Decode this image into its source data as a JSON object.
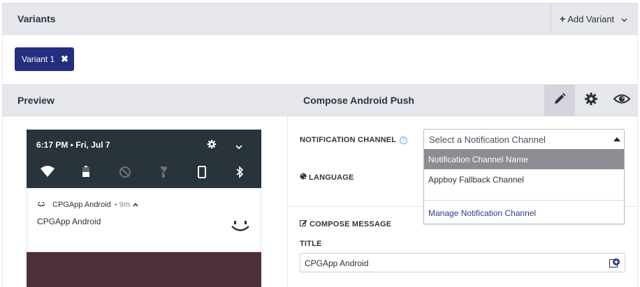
{
  "variants": {
    "title": "Variants",
    "add_variant_label": "Add Variant",
    "chips": [
      {
        "label": "Variant 1",
        "close": "✖"
      }
    ]
  },
  "preview": {
    "title": "Preview",
    "phone": {
      "time": "6:17 PM • Fri, Jul 7",
      "app_name": "CPGApp Android",
      "app_time": "9m",
      "body": "CPGApp Android"
    }
  },
  "compose": {
    "title": "Compose Android Push",
    "toolbar": [
      "pencil-icon",
      "gear-icon",
      "eye-icon"
    ],
    "notification_channel_label": "NOTIFICATION CHANNEL",
    "language_label": "LANGUAGE",
    "compose_message_label": "COMPOSE MESSAGE",
    "title_label": "TITLE",
    "title_value": "CPGApp Android",
    "channel_select": {
      "placeholder": "Select a Notification Channel",
      "options": [
        "Notification Channel Name",
        "Appboy Fallback Channel"
      ],
      "manage_link": "Manage Notification Channel"
    }
  },
  "colors": {
    "chip_bg": "#232e7e",
    "bar_bg": "#e6e7ec",
    "phone_status_bg": "#28333a",
    "highlight": "#8c8d92",
    "link": "#2c3c8c"
  }
}
